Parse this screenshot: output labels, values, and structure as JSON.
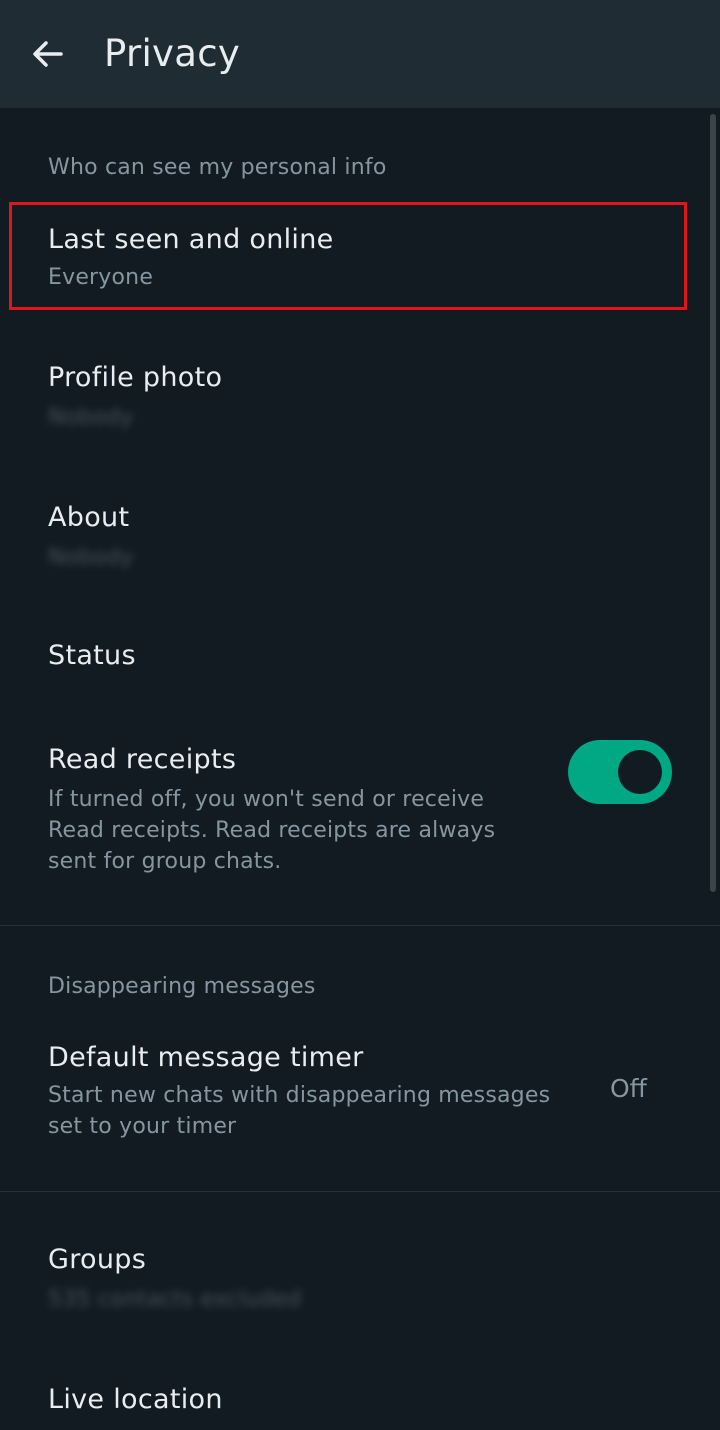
{
  "header": {
    "back_icon": "arrow-left-icon",
    "title": "Privacy"
  },
  "sections": {
    "personal_info": {
      "label": "Who can see my personal info",
      "items": [
        {
          "title": "Last seen and online",
          "value": "Everyone"
        },
        {
          "title": "Profile photo",
          "value": "Nobody"
        },
        {
          "title": "About",
          "value": "Nobody"
        },
        {
          "title": "Status"
        },
        {
          "title": "Read receipts",
          "description": "If turned off, you won't send or receive Read receipts. Read receipts are always sent for group chats.",
          "enabled": true
        }
      ]
    },
    "disappearing": {
      "label": "Disappearing messages",
      "items": [
        {
          "title": "Default message timer",
          "description": "Start new chats with disappearing messages set to your timer",
          "value": "Off"
        }
      ]
    },
    "more": {
      "items": [
        {
          "title": "Groups",
          "value": "535 contacts excluded"
        },
        {
          "title": "Live location"
        }
      ]
    }
  },
  "colors": {
    "background": "#121b22",
    "appbar": "#1f2c34",
    "accent": "#00a884",
    "highlight": "#e0161d"
  }
}
